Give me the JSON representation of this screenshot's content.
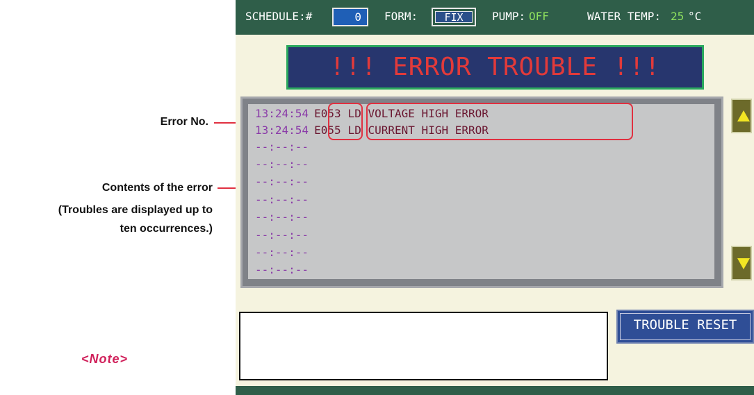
{
  "annotations": {
    "error_no": "Error No.",
    "contents": "Contents of the error",
    "contents_note_1": "(Troubles are displayed up to",
    "contents_note_2": "ten occurrences.)",
    "note": "<Note>"
  },
  "status_bar": {
    "schedule_label": "SCHEDULE:#",
    "schedule_value": "0",
    "form_label": "FORM:",
    "form_value": "FIX",
    "pump_label": "PUMP:",
    "pump_value": "OFF",
    "water_temp_label": "WATER TEMP:",
    "water_temp_value": "25",
    "water_temp_unit": "°C"
  },
  "banner": "!!! ERROR TROUBLE !!!",
  "errors": [
    {
      "time": "13:24:54",
      "code": "E053",
      "message": "LD VOLTAGE HIGH ERROR"
    },
    {
      "time": "13:24:54",
      "code": "E055",
      "message": "LD CURRENT HIGH ERROR"
    },
    {
      "time": "--:--:--",
      "code": "",
      "message": ""
    },
    {
      "time": "--:--:--",
      "code": "",
      "message": ""
    },
    {
      "time": "--:--:--",
      "code": "",
      "message": ""
    },
    {
      "time": "--:--:--",
      "code": "",
      "message": ""
    },
    {
      "time": "--:--:--",
      "code": "",
      "message": ""
    },
    {
      "time": "--:--:--",
      "code": "",
      "message": ""
    },
    {
      "time": "--:--:--",
      "code": "",
      "message": ""
    },
    {
      "time": "--:--:--",
      "code": "",
      "message": ""
    }
  ],
  "buttons": {
    "scroll_up_icon": "triangle-up-icon",
    "scroll_down_icon": "triangle-down-icon",
    "trouble_reset": "TROUBLE RESET"
  },
  "colors": {
    "header_bg": "#2f5e49",
    "accent_green": "#8ee05e",
    "banner_bg": "#27366e",
    "banner_text": "#e23a3a",
    "callout": "#e03040"
  }
}
